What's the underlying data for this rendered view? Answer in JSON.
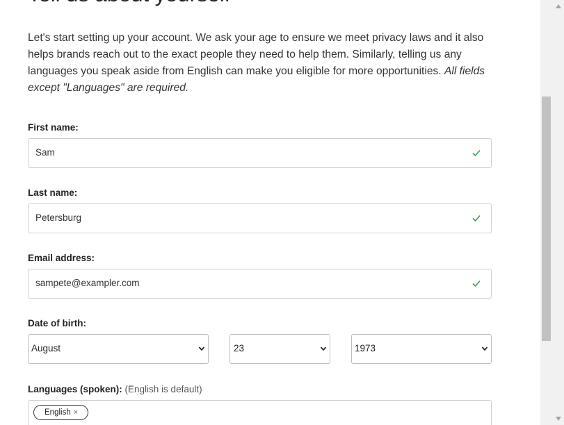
{
  "header": {
    "title": "Tell us about yourself"
  },
  "intro": {
    "text": "Let's start setting up your account. We ask your age to ensure we meet privacy laws and it also helps brands reach out to the exact people they need to help them. Similarly, telling us any languages you speak aside from English can make you eligible for more opportunities.",
    "note": "All fields except \"Languages\" are required."
  },
  "form": {
    "first_name": {
      "label": "First name:",
      "value": "Sam",
      "status_icon": "check-icon"
    },
    "last_name": {
      "label": "Last name:",
      "value": "Petersburg",
      "status_icon": "check-icon"
    },
    "email": {
      "label": "Email address:",
      "value": "sampete@exampler.com",
      "status_icon": "check-icon"
    },
    "dob": {
      "label": "Date of birth:",
      "month": "August",
      "day": "23",
      "year": "1973"
    },
    "languages": {
      "label": "Languages (spoken):",
      "hint": "(English is default)",
      "tags": [
        "English"
      ],
      "remove_glyph": "×"
    }
  },
  "colors": {
    "valid_check": "#2e9e5b",
    "border": "#cfcfcf",
    "text": "#222222"
  }
}
